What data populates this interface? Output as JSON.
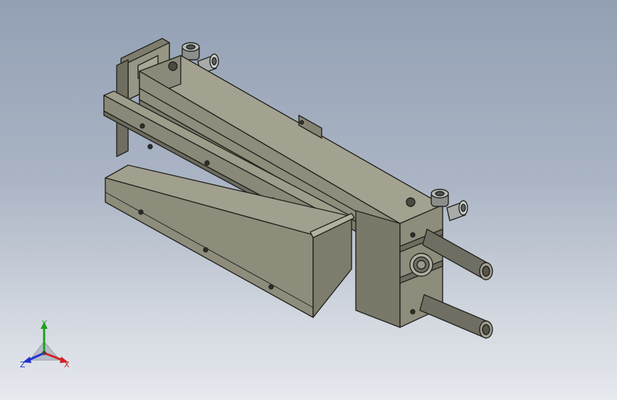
{
  "viewport": {
    "background_top": "#93a0b4",
    "background_bottom": "#e6e9ee"
  },
  "model": {
    "body_color": "#8e8d7c",
    "edge_color": "#23231f"
  },
  "triad": {
    "x_label": "X",
    "y_label": "Y",
    "z_label": "Z",
    "x_color": "#d42020",
    "y_color": "#1fa01f",
    "z_color": "#2030d0"
  }
}
